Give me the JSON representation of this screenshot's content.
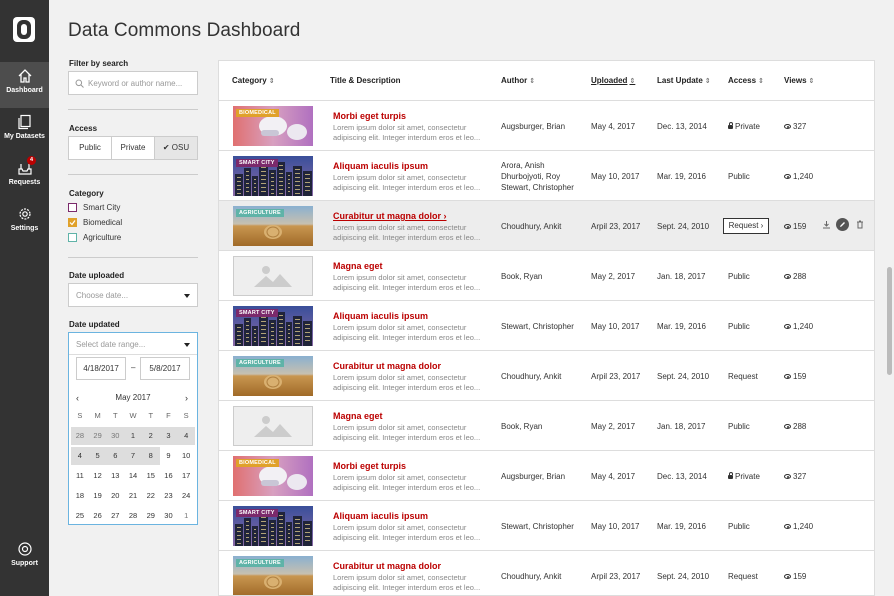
{
  "sidebar": {
    "items": [
      {
        "label": "Dashboard",
        "icon": "home-icon"
      },
      {
        "label": "My Datasets",
        "icon": "datasets-icon"
      },
      {
        "label": "Requests",
        "icon": "requests-icon",
        "badge": "4"
      },
      {
        "label": "Settings",
        "icon": "gear-icon"
      }
    ],
    "support_label": "Support"
  },
  "page_title": "Data Commons Dashboard",
  "filters": {
    "search_label": "Filter by search",
    "search_placeholder": "Keyword or author name...",
    "access_label": "Access",
    "access_options": [
      "Public",
      "Private",
      "OSU"
    ],
    "access_selected": "OSU",
    "category_label": "Category",
    "categories": [
      {
        "label": "Smart City",
        "checked": false,
        "color": "#7b2a6b"
      },
      {
        "label": "Biomedical",
        "checked": true,
        "color": "#e0a12a"
      },
      {
        "label": "Agriculture",
        "checked": false,
        "color": "#5fb3a8"
      }
    ],
    "date_uploaded_label": "Date uploaded",
    "date_uploaded_placeholder": "Choose date...",
    "date_updated_label": "Date updated",
    "date_updated_placeholder": "Select date range...",
    "date_from": "4/18/2017",
    "date_to": "5/8/2017",
    "calendar_month": "May 2017",
    "calendar_days_header": [
      "S",
      "M",
      "T",
      "W",
      "T",
      "F",
      "S"
    ],
    "calendar_weeks": [
      [
        "28",
        "29",
        "30",
        "1",
        "2",
        "3",
        "4"
      ],
      [
        "4",
        "5",
        "6",
        "7",
        "8",
        "9",
        "10"
      ],
      [
        "11",
        "12",
        "13",
        "14",
        "15",
        "16",
        "17"
      ],
      [
        "18",
        "19",
        "20",
        "21",
        "22",
        "23",
        "24"
      ],
      [
        "25",
        "26",
        "27",
        "28",
        "29",
        "30",
        "1"
      ]
    ]
  },
  "table": {
    "columns": [
      "Category",
      "Title & Description",
      "Author",
      "Uploaded",
      "Last Update",
      "Access",
      "Views"
    ],
    "sorted_column": "Uploaded",
    "rows": [
      {
        "category": "BIOMEDICAL",
        "title": "Morbi eget turpis",
        "desc": "Lorem ipsum dolor sit amet, consectetur adipiscing elit. Integer interdum eros et leo...",
        "author": "Augsburger, Brian",
        "uploaded": "May 4, 2017",
        "updated": "Dec. 13, 2014",
        "access": "Private",
        "views": "327"
      },
      {
        "category": "SMART CITY",
        "title": "Aliquam iaculis ipsum",
        "desc": "Lorem ipsum dolor sit amet, consectetur adipiscing elit. Integer interdum eros et leo...",
        "author": "Arora, Anish\nDhurbojyoti, Roy\nStewart, Christopher",
        "uploaded": "May 10, 2017",
        "updated": "Mar. 19, 2016",
        "access": "Public",
        "views": "1,240"
      },
      {
        "category": "AGRICULTURE",
        "title": "Curabitur ut magna dolor",
        "desc": "Lorem ipsum dolor sit amet, consectetur adipiscing elit. Integer interdum eros et leo...",
        "author": "Choudhury, Ankit",
        "uploaded": "Arpil 23, 2017",
        "updated": "Sept. 24, 2010",
        "access": "Request",
        "views": "159"
      },
      {
        "category": "",
        "title": "Magna eget",
        "desc": "Lorem ipsum dolor sit amet, consectetur adipiscing elit. Integer interdum eros et leo...",
        "author": "Book, Ryan",
        "uploaded": "May 2, 2017",
        "updated": "Jan. 18, 2017",
        "access": "Public",
        "views": "288"
      },
      {
        "category": "SMART CITY",
        "title": "Aliquam iaculis ipsum",
        "desc": "Lorem ipsum dolor sit amet, consectetur adipiscing elit. Integer interdum eros et leo...",
        "author": "Stewart, Christopher",
        "uploaded": "May 10, 2017",
        "updated": "Mar. 19, 2016",
        "access": "Public",
        "views": "1,240"
      },
      {
        "category": "AGRICULTURE",
        "title": "Curabitur ut magna dolor",
        "desc": "Lorem ipsum dolor sit amet, consectetur adipiscing elit. Integer interdum eros et leo...",
        "author": "Choudhury, Ankit",
        "uploaded": "Arpil 23, 2017",
        "updated": "Sept. 24, 2010",
        "access": "Request",
        "views": "159"
      },
      {
        "category": "",
        "title": "Magna eget",
        "desc": "Lorem ipsum dolor sit amet, consectetur adipiscing elit. Integer interdum eros et leo...",
        "author": "Book, Ryan",
        "uploaded": "May 2, 2017",
        "updated": "Jan. 18, 2017",
        "access": "Public",
        "views": "288"
      },
      {
        "category": "BIOMEDICAL",
        "title": "Morbi eget turpis",
        "desc": "Lorem ipsum dolor sit amet, consectetur adipiscing elit. Integer interdum eros et leo...",
        "author": "Augsburger, Brian",
        "uploaded": "May 4, 2017",
        "updated": "Dec. 13, 2014",
        "access": "Private",
        "views": "327"
      },
      {
        "category": "SMART CITY",
        "title": "Aliquam iaculis ipsum",
        "desc": "Lorem ipsum dolor sit amet, consectetur adipiscing elit. Integer interdum eros et leo...",
        "author": "Stewart, Christopher",
        "uploaded": "May 10, 2017",
        "updated": "Mar. 19, 2016",
        "access": "Public",
        "views": "1,240"
      },
      {
        "category": "AGRICULTURE",
        "title": "Curabitur ut magna dolor",
        "desc": "Lorem ipsum dolor sit amet, consectetur adipiscing elit. Integer interdum eros et leo...",
        "author": "Choudhury, Ankit",
        "uploaded": "Arpil 23, 2017",
        "updated": "Sept. 24, 2010",
        "access": "Request",
        "views": "159"
      }
    ]
  },
  "colors": {
    "accent": "#bb0000",
    "sidebar_bg": "#333333",
    "biomedical_tag": "#e0a12a",
    "smart_city_tag": "#7b2a6b",
    "agriculture_tag": "#5fb3a8"
  }
}
